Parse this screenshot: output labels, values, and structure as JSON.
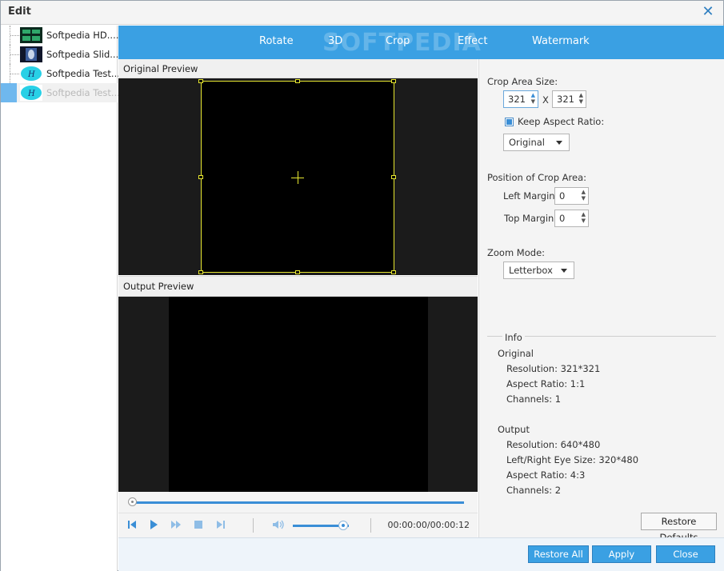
{
  "window": {
    "title": "Edit"
  },
  "files": [
    {
      "name": "Softpedia HD...."
    },
    {
      "name": "Softpedia Slid..."
    },
    {
      "name": "Softpedia Test..."
    },
    {
      "name": "Softpedia Test..."
    }
  ],
  "tabs": [
    {
      "label": "Rotate"
    },
    {
      "label": "3D"
    },
    {
      "label": "Crop"
    },
    {
      "label": "Effect"
    },
    {
      "label": "Watermark"
    }
  ],
  "watermark_text": "SOFTPEDIA",
  "preview": {
    "original_label": "Original Preview",
    "output_label": "Output Preview"
  },
  "playback": {
    "time": "00:00:00/00:00:12",
    "seek_fraction": 0.0,
    "volume_fraction": 0.9
  },
  "crop": {
    "area_size_label": "Crop Area Size:",
    "width": "321",
    "x_label": "X",
    "height": "321",
    "keep_aspect_label": "Keep Aspect Ratio:",
    "keep_aspect_checked": true,
    "aspect_value": "Original",
    "position_label": "Position of Crop Area:",
    "left_margin_label": "Left Margin:",
    "left_margin": "0",
    "top_margin_label": "Top Margin:",
    "top_margin": "0",
    "zoom_label": "Zoom Mode:",
    "zoom_value": "Letterbox"
  },
  "info": {
    "title": "Info",
    "original_label": "Original",
    "original": [
      "Resolution: 321*321",
      "Aspect Ratio: 1:1",
      "Channels: 1"
    ],
    "output_label": "Output",
    "output": [
      "Resolution: 640*480",
      "Left/Right Eye Size: 320*480",
      "Aspect Ratio: 4:3",
      "Channels: 2"
    ]
  },
  "buttons": {
    "restore_defaults": "Restore Defaults",
    "restore_all": "Restore All",
    "apply": "Apply",
    "close": "Close"
  },
  "colors": {
    "accent": "#3aa0e3",
    "crop_border": "#e8e830"
  }
}
